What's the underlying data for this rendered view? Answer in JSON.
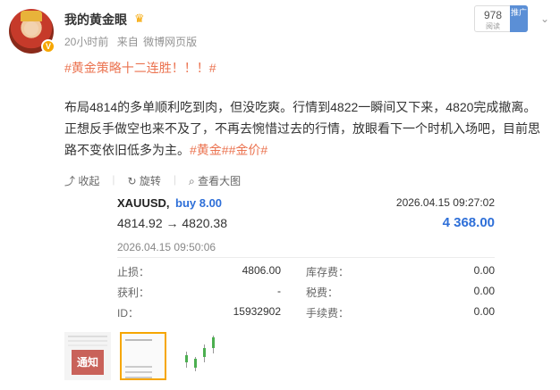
{
  "post": {
    "username": "我的黄金眼",
    "time": "20小时前",
    "source_prefix": "来自",
    "source": "微博网页版",
    "topic": "#黄金策略十二连胜！！！#",
    "body": "布局4814的多单顺利吃到肉，但没吃爽。行情到4822一瞬间又下来，4820完成撤离。正想反手做空也来不及了，不再去惋惜过去的行情，放眼看下一个时机入场吧，目前思路不变依旧低多为主。",
    "tags": "#黄金##金价#",
    "count": "978",
    "count_label": "阅读",
    "promote_label": "推广"
  },
  "actions": {
    "collapse": "收起",
    "rotate": "旋转",
    "view_large": "查看大图"
  },
  "card": {
    "symbol": "XAUUSD,",
    "direction": "buy 8.00",
    "open_time": "2026.04.15 09:27:02",
    "prices": "4814.92 → 4820.38",
    "profit": "4 368.00",
    "close_time": "2026.04.15 09:50:06",
    "rows": [
      {
        "l_label": "止损：",
        "l_value": "4806.00",
        "r_label": "库存费：",
        "r_value": "0.00"
      },
      {
        "l_label": "获利：",
        "l_value": "-",
        "r_label": "税费：",
        "r_value": "0.00"
      },
      {
        "l_label": "ID：",
        "l_value": "15932902",
        "r_label": "手续费：",
        "r_value": "0.00"
      }
    ]
  },
  "thumbs": {
    "notice_label": "通知"
  }
}
